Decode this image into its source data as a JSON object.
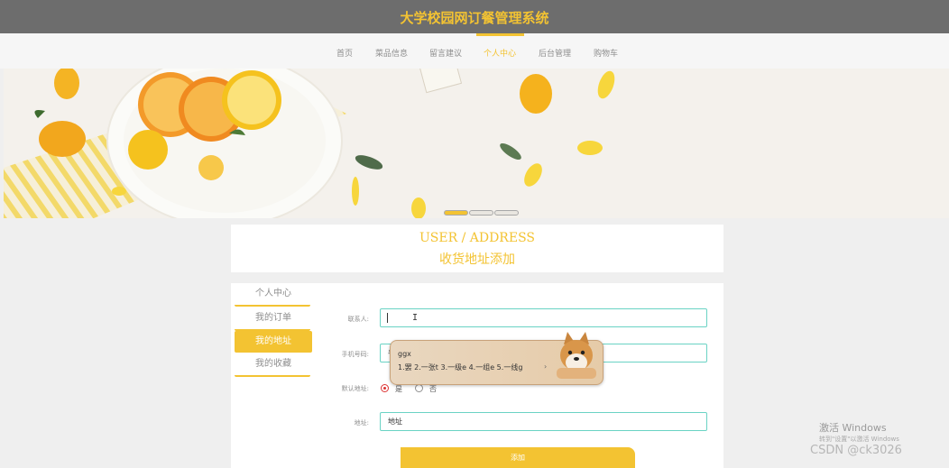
{
  "header": {
    "title": "大学校园网订餐管理系统"
  },
  "nav": {
    "items": [
      {
        "label": "首页"
      },
      {
        "label": "菜品信息"
      },
      {
        "label": "留言建议"
      },
      {
        "label": "个人中心"
      },
      {
        "label": "后台管理"
      },
      {
        "label": "购物车"
      }
    ],
    "active": "个人中心"
  },
  "banner": {
    "slides": 3,
    "active_slide": 1
  },
  "page_heading": {
    "en": "USER / ADDRESS",
    "zh": "收货地址添加"
  },
  "sidebar": {
    "items": [
      {
        "label": "个人中心"
      },
      {
        "label": "我的订单"
      },
      {
        "label": "我的地址"
      },
      {
        "label": "我的收藏"
      }
    ],
    "active": "我的地址"
  },
  "form": {
    "contact_label": "联系人:",
    "contact_value": "",
    "phone_label": "手机号码:",
    "phone_value": "手",
    "default_label": "默认地址:",
    "default_yes": "是",
    "default_no": "否",
    "default_selected": "是",
    "address_label": "地址:",
    "address_value": "地址",
    "submit_label": "添加"
  },
  "ime": {
    "composition": "ggx",
    "candidates": "1.罢  2.一张t  3.一级e  4.一组e  5.一线g",
    "next_arrow": "›"
  },
  "overlay": {
    "activate_windows": "激活 Windows",
    "activate_hint": "转到\"设置\"以激活 Windows",
    "csdn_mark": "CSDN @ck3026"
  },
  "colors": {
    "accent": "#f3c332",
    "header_bg": "#6d6d6d",
    "input_border": "#6ad3c4"
  }
}
